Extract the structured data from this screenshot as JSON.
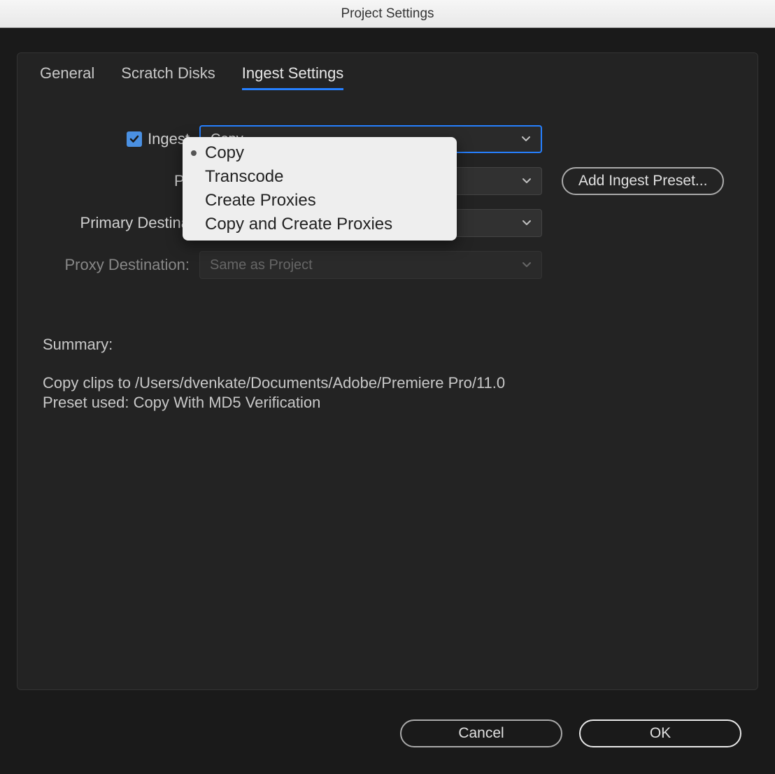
{
  "window": {
    "title": "Project Settings"
  },
  "tabs": {
    "general": "General",
    "scratch": "Scratch Disks",
    "ingest": "Ingest Settings",
    "active": "ingest"
  },
  "form": {
    "ingest_label": "Ingest",
    "ingest_checked": true,
    "ingest_value": "Copy",
    "preset_label_partial": "Pr",
    "primary_dest_label_partial": "Primary Destina",
    "proxy_dest_label": "Proxy Destination:",
    "proxy_dest_value": "Same as Project",
    "add_preset_btn": "Add Ingest Preset..."
  },
  "ingest_options": {
    "o0": "Copy",
    "o1": "Transcode",
    "o2": "Create Proxies",
    "o3": "Copy and Create Proxies",
    "selected_index": 0
  },
  "summary": {
    "heading": "Summary:",
    "line1": "Copy clips to /Users/dvenkate/Documents/Adobe/Premiere Pro/11.0",
    "line2": "Preset used: Copy With MD5 Verification"
  },
  "buttons": {
    "cancel": "Cancel",
    "ok": "OK"
  }
}
